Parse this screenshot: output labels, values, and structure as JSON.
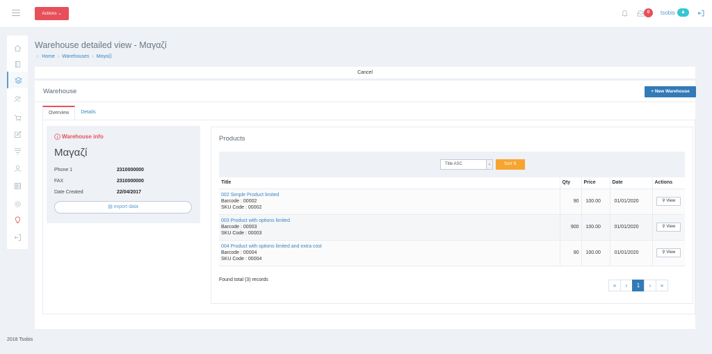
{
  "topbar": {
    "actions_label": "Actions",
    "notifications_count": "0",
    "username": "tsobis"
  },
  "page": {
    "title": "Warehouse detailed view - Μαγαζί",
    "breadcrumb": [
      "Home",
      "Warehouses",
      "Μαγαζί"
    ]
  },
  "cancel_label": "Cancel",
  "panel": {
    "title": "Warehouse",
    "new_button": "New Warehouse",
    "tabs": [
      "Overview",
      "Details"
    ]
  },
  "info": {
    "heading": "Warehouse info",
    "name": "Μαγαζί",
    "rows": [
      {
        "label": "Phone 1",
        "value": "2310000000"
      },
      {
        "label": "FAX",
        "value": "2310000000"
      },
      {
        "label": "Date Created",
        "value": "22/04/2017"
      }
    ],
    "export_label": "export data"
  },
  "products": {
    "title": "Products",
    "sort_selected": "Title ASC",
    "sort_label": "Sort",
    "columns": [
      "Title",
      "Qty",
      "Price",
      "Date",
      "Actions"
    ],
    "rows": [
      {
        "title": "002 Simple Product limited",
        "barcode": "Barcode : 00002",
        "sku": "SKU Code : 00002",
        "qty": "90",
        "price": "100.00",
        "date": "01/01/2020",
        "action": "View"
      },
      {
        "title": "003 Product with options limited",
        "barcode": "Barcode : 00003",
        "sku": "SKU Code : 00003",
        "qty": "900",
        "price": "100.00",
        "date": "01/01/2020",
        "action": "View"
      },
      {
        "title": "004 Product with options limited and extra cost",
        "barcode": "Barcode : 00004",
        "sku": "SKU Code : 00004",
        "qty": "90",
        "price": "100.00",
        "date": "01/01/2020",
        "action": "View"
      }
    ],
    "records_text": "Found total (3) records",
    "pagination": [
      "«",
      "‹",
      "1",
      "›",
      "»"
    ]
  },
  "footer": "2018 Tsobis",
  "colors": {
    "accent_red": "#e7505a",
    "primary_blue": "#337ab7",
    "sort_orange": "#f7a52f",
    "link_blue": "#3b84c4"
  }
}
